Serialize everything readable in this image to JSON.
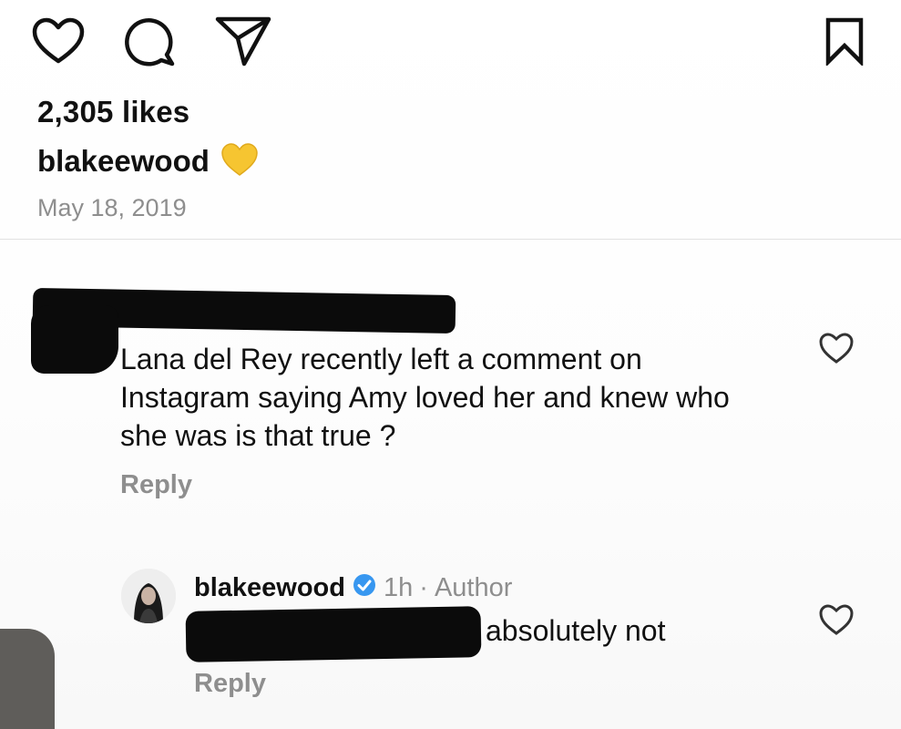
{
  "actions": {
    "like_icon": "heart-outline",
    "comment_icon": "speech-bubble",
    "share_icon": "paper-plane",
    "save_icon": "bookmark"
  },
  "post": {
    "likes": "2,305 likes",
    "username": "blakeewood",
    "caption_emoji": "yellow-heart",
    "date": "May 18, 2019"
  },
  "comments": [
    {
      "username_redacted": true,
      "text": "Lana del Rey recently left a comment on Instagram saying Amy loved her and knew who she was is that true ?",
      "reply_label": "Reply"
    }
  ],
  "reply": {
    "username": "blakeewood",
    "verified": true,
    "time": "1h",
    "separator": "·",
    "role": "Author",
    "text": "absolutely not",
    "reply_label": "Reply"
  },
  "colors": {
    "text_primary": "#111111",
    "text_secondary": "#8e8e8e",
    "verified_blue": "#3797f0",
    "emoji_yellow": "#f6c531",
    "redaction": "#0b0b0b"
  }
}
